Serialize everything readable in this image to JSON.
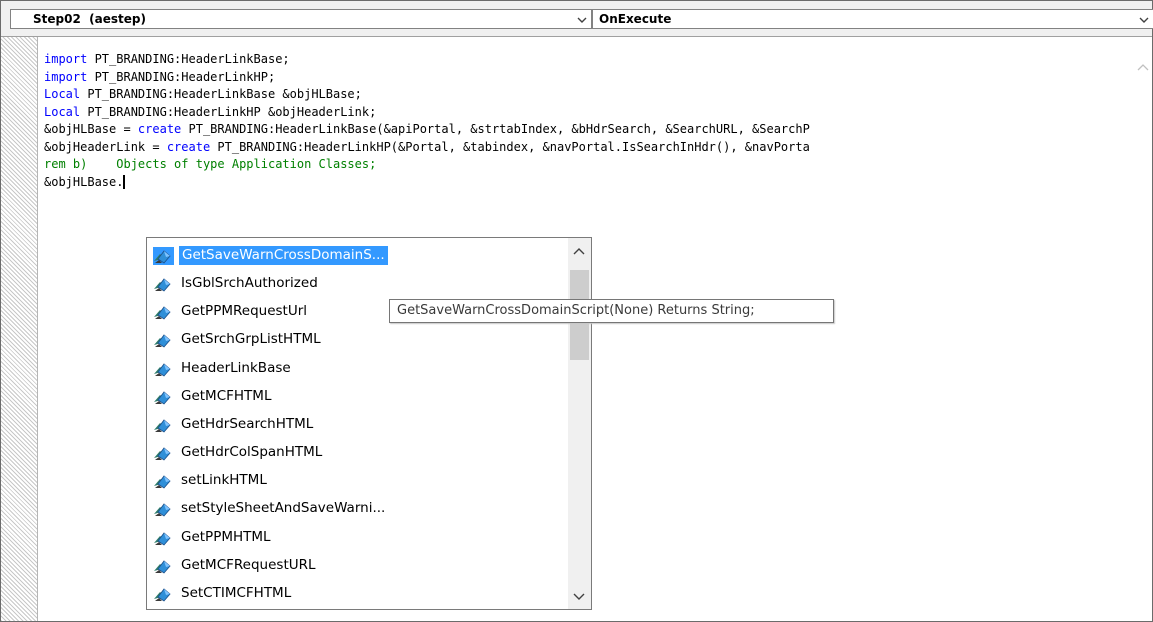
{
  "header": {
    "object_combo": {
      "value": "Step02  (aestep)"
    },
    "event_combo": {
      "value": "OnExecute"
    }
  },
  "code_lines": [
    {
      "segments": [
        {
          "t": "import",
          "c": "kw"
        },
        {
          "t": " PT_BRANDING:HeaderLinkBase;",
          "c": ""
        }
      ]
    },
    {
      "segments": [
        {
          "t": "import",
          "c": "kw"
        },
        {
          "t": " PT_BRANDING:HeaderLinkHP;",
          "c": ""
        }
      ]
    },
    {
      "segments": [
        {
          "t": "Local",
          "c": "kw"
        },
        {
          "t": " PT_BRANDING:HeaderLinkBase &objHLBase;",
          "c": ""
        }
      ]
    },
    {
      "segments": [
        {
          "t": "Local",
          "c": "kw"
        },
        {
          "t": " PT_BRANDING:HeaderLinkHP &objHeaderLink;",
          "c": ""
        }
      ]
    },
    {
      "segments": [
        {
          "t": "&objHLBase = ",
          "c": ""
        },
        {
          "t": "create",
          "c": "kw"
        },
        {
          "t": " PT_BRANDING:HeaderLinkBase(&apiPortal, &strtabIndex, &bHdrSearch, &SearchURL, &SearchP",
          "c": ""
        }
      ]
    },
    {
      "segments": [
        {
          "t": "&objHeaderLink = ",
          "c": ""
        },
        {
          "t": "create",
          "c": "kw"
        },
        {
          "t": " PT_BRANDING:HeaderLinkHP(&Portal, &tabindex, &navPortal.IsSearchInHdr(), &navPorta",
          "c": ""
        }
      ]
    },
    {
      "segments": [
        {
          "t": "rem b)    Objects of type Application Classes;",
          "c": "cm"
        }
      ]
    },
    {
      "segments": [
        {
          "t": "&objHLBase.",
          "c": ""
        }
      ],
      "caret": true
    }
  ],
  "autocomplete": {
    "items": [
      {
        "label": "GetSaveWarnCrossDomainS...",
        "selected": true
      },
      {
        "label": "IsGblSrchAuthorized"
      },
      {
        "label": "GetPPMRequestUrl"
      },
      {
        "label": "GetSrchGrpListHTML"
      },
      {
        "label": "HeaderLinkBase"
      },
      {
        "label": "GetMCFHTML"
      },
      {
        "label": "GetHdrSearchHTML"
      },
      {
        "label": "GetHdrColSpanHTML"
      },
      {
        "label": "setLinkHTML"
      },
      {
        "label": "setStyleSheetAndSaveWarni..."
      },
      {
        "label": "GetPPMHTML"
      },
      {
        "label": "GetMCFRequestURL"
      },
      {
        "label": "SetCTIMCFHTML"
      }
    ],
    "item_icon": "method-icon"
  },
  "tooltip": {
    "text": "GetSaveWarnCrossDomainScript(None) Returns String;"
  },
  "colors": {
    "keyword": "#0000ff",
    "comment": "#008000",
    "selection": "#3399ff"
  }
}
